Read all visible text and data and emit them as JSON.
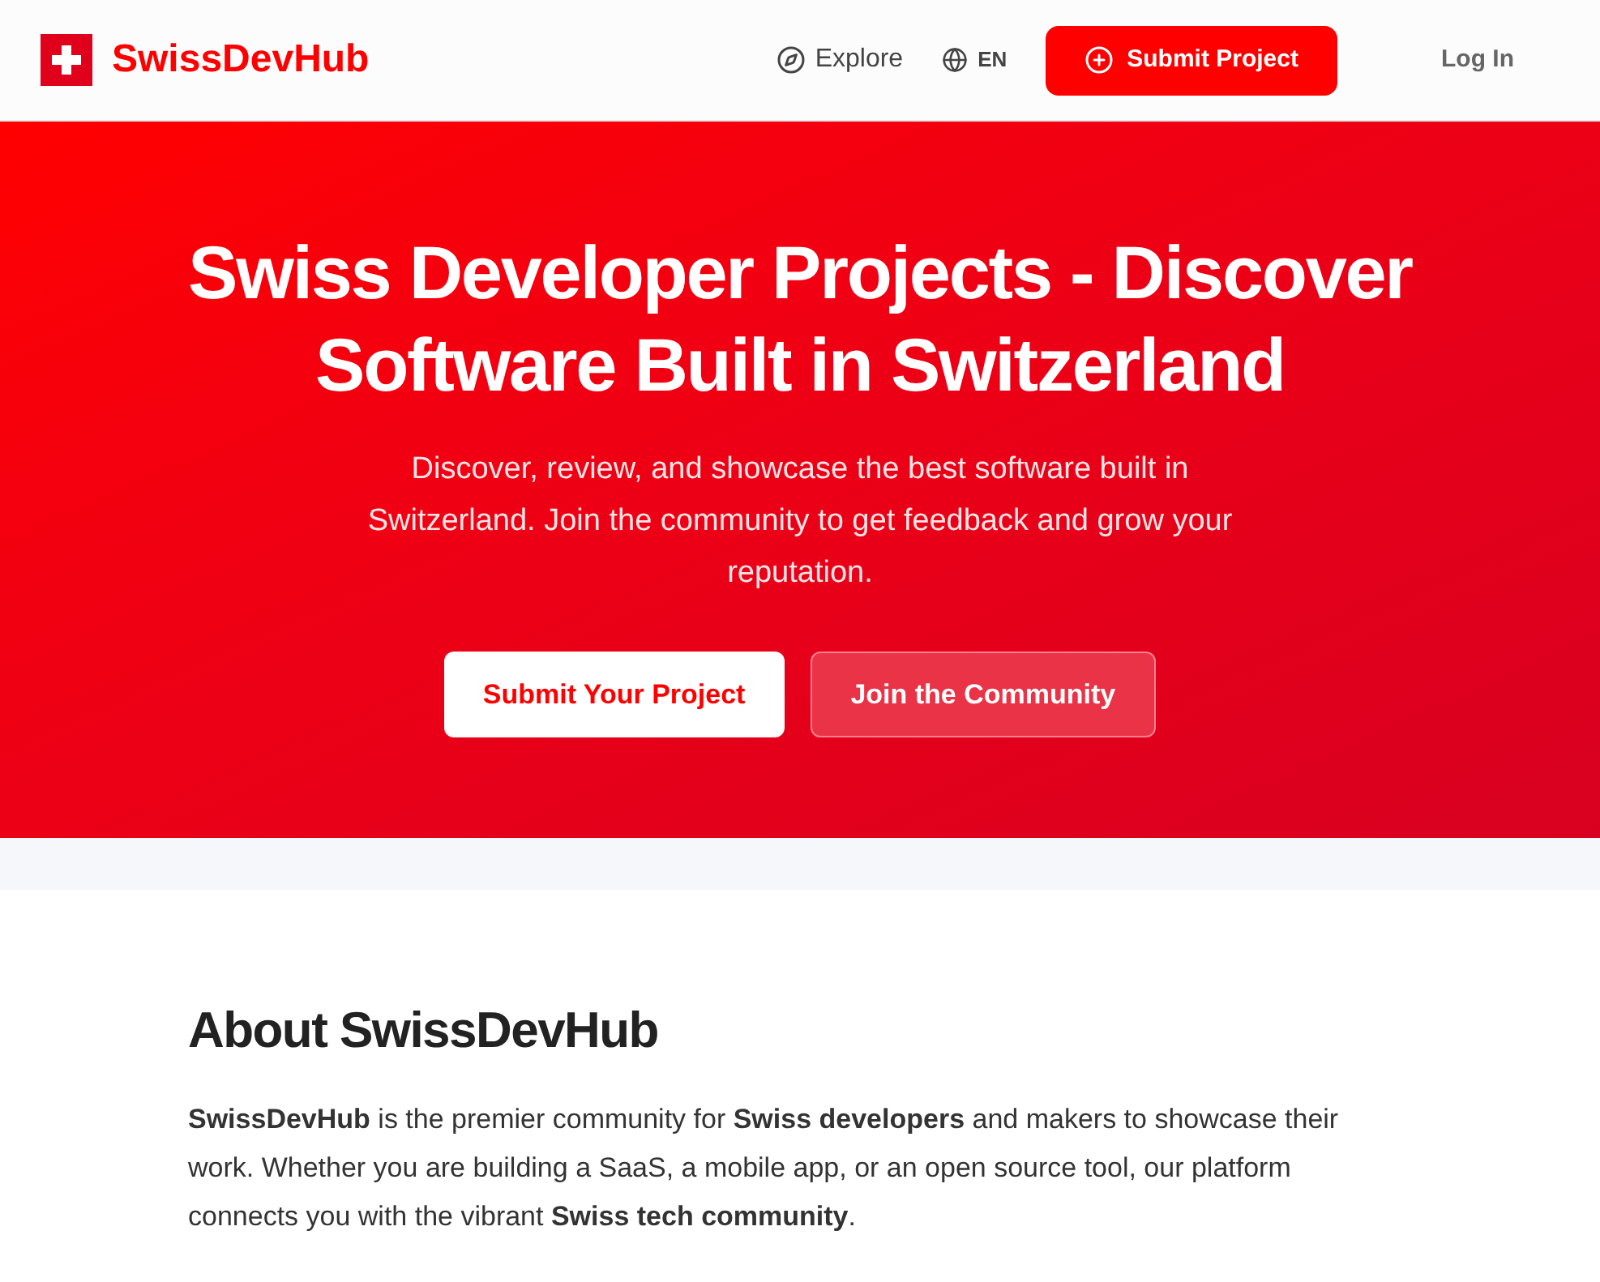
{
  "header": {
    "brand": "SwissDevHub",
    "nav": [
      {
        "label": "Explore"
      },
      {
        "label": "EN"
      }
    ],
    "submit": "Submit Project",
    "login": "Log In"
  },
  "hero": {
    "title": "Swiss Developer Projects - Discover Software Built in Switzerland",
    "subtitle": "Discover, review, and showcase the best software built in Switzerland. Join the community to get feedback and grow your reputation.",
    "buttons": [
      "Submit Your Project",
      "Join the Community"
    ]
  },
  "about": {
    "title": "About SwissDevHub",
    "text": "**SwissDevHub** is the premier community for **Swiss developers** and makers to showcase their work. Whether you are building a SaaS, a mobile app, or an open source tool, our platform connects you with the vibrant **Swiss tech community**."
  }
}
